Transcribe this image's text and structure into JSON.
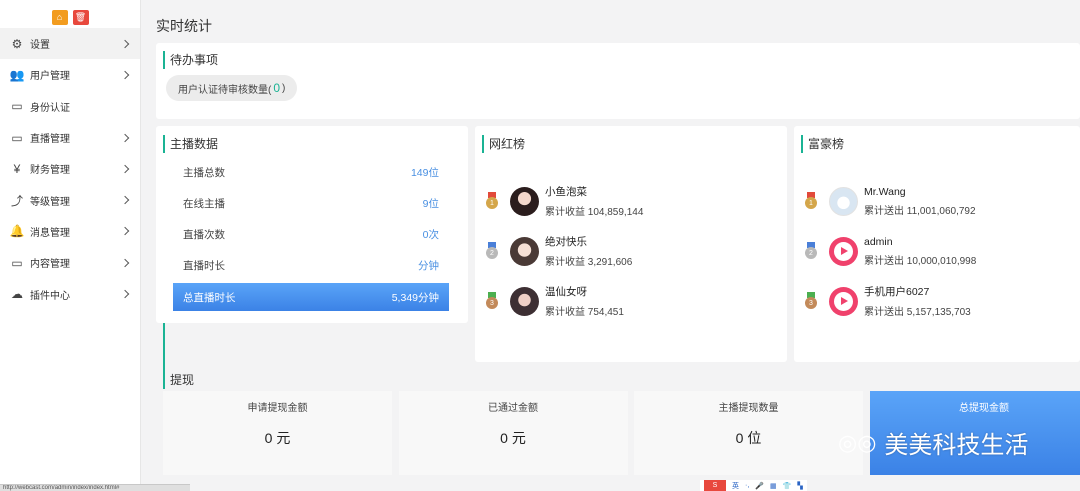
{
  "sidebar": {
    "items": [
      {
        "label": "设置",
        "icon": "gears-icon",
        "glyph": "⚙",
        "active": true,
        "has_arrow": true
      },
      {
        "label": "用户管理",
        "icon": "users-icon",
        "glyph": "👥",
        "active": false,
        "has_arrow": true
      },
      {
        "label": "身份认证",
        "icon": "monitor-icon",
        "glyph": "▭",
        "active": false,
        "has_arrow": false
      },
      {
        "label": "直播管理",
        "icon": "monitor-icon",
        "glyph": "▭",
        "active": false,
        "has_arrow": true
      },
      {
        "label": "财务管理",
        "icon": "yen-icon",
        "glyph": "¥",
        "active": false,
        "has_arrow": true
      },
      {
        "label": "等级管理",
        "icon": "level-up-icon",
        "glyph": "⤴",
        "active": false,
        "has_arrow": true
      },
      {
        "label": "消息管理",
        "icon": "bell-icon",
        "glyph": "🔔",
        "active": false,
        "has_arrow": true
      },
      {
        "label": "内容管理",
        "icon": "monitor-icon",
        "glyph": "▭",
        "active": false,
        "has_arrow": true
      },
      {
        "label": "插件中心",
        "icon": "cloud-icon",
        "glyph": "☁",
        "active": false,
        "has_arrow": true
      }
    ]
  },
  "page": {
    "title": "实时统计"
  },
  "todo": {
    "title": "待办事项",
    "pending_label": "用户认证待审核数量(",
    "pending_count": "0",
    "pending_close": ")"
  },
  "anchor": {
    "title": "主播数据",
    "rows": [
      {
        "label": "主播总数",
        "value": "149位"
      },
      {
        "label": "在线主播",
        "value": "9位"
      },
      {
        "label": "直播次数",
        "value": "0次"
      },
      {
        "label": "直播时长",
        "value": "分钟"
      },
      {
        "label": "总直播时长",
        "value": "5,349分钟"
      }
    ]
  },
  "influencer_rank": {
    "title": "网红榜",
    "entries": [
      {
        "rank": "1",
        "name": "小鱼泡菜",
        "stat": "累计收益 104,859,144"
      },
      {
        "rank": "2",
        "name": "绝对快乐",
        "stat": "累计收益 3,291,606"
      },
      {
        "rank": "3",
        "name": "温仙女呀",
        "stat": "累计收益 754,451"
      }
    ]
  },
  "rich_rank": {
    "title": "富豪榜",
    "entries": [
      {
        "rank": "1",
        "name": "Mr.Wang",
        "stat": "累计送出 11,001,060,792"
      },
      {
        "rank": "2",
        "name": "admin",
        "stat": "累计送出 10,000,010,998"
      },
      {
        "rank": "3",
        "name": "手机用户6027",
        "stat": "累计送出 5,157,135,703"
      }
    ]
  },
  "withdraw": {
    "title": "提现",
    "boxes": [
      {
        "label": "申请提现金额",
        "value": "0 元"
      },
      {
        "label": "已通过金额",
        "value": "0 元"
      },
      {
        "label": "主播提现数量",
        "value": "0 位"
      },
      {
        "label": "总提现金额",
        "value": ""
      }
    ]
  },
  "watermark": {
    "text": "美美科技生活"
  },
  "statusbar": {
    "url": "http://webcast.com/admin/index/index.html#"
  },
  "imebar": {
    "lang": "英"
  }
}
